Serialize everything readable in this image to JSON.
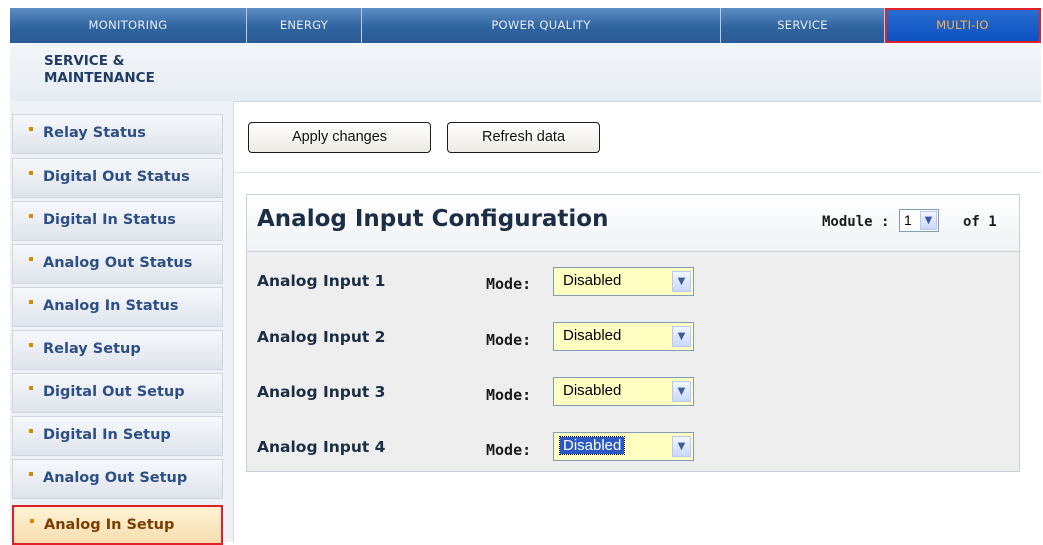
{
  "topnav": {
    "tabs": [
      {
        "label": "MONITORING"
      },
      {
        "label": "ENERGY"
      },
      {
        "label": "POWER QUALITY"
      },
      {
        "label": "SERVICE"
      },
      {
        "label": "MULTI-IO"
      }
    ],
    "active": "MULTI-IO"
  },
  "section": {
    "title": "SERVICE & MAINTENANCE"
  },
  "sidebar": {
    "items": [
      {
        "label": "Relay Status"
      },
      {
        "label": "Digital Out Status"
      },
      {
        "label": "Digital In Status"
      },
      {
        "label": "Analog Out Status"
      },
      {
        "label": "Analog In Status"
      },
      {
        "label": "Relay Setup"
      },
      {
        "label": "Digital Out Setup"
      },
      {
        "label": "Digital In Setup"
      },
      {
        "label": "Analog Out Setup"
      },
      {
        "label": "Analog In Setup"
      }
    ],
    "active": "Analog In Setup"
  },
  "toolbar": {
    "apply_label": "Apply changes",
    "refresh_label": "Refresh data"
  },
  "panel": {
    "title": "Analog Input Configuration",
    "module_label": "Module :",
    "module_value": "1",
    "of_label": "of 1",
    "rows": [
      {
        "label": "Analog Input 1",
        "mode_label": "Mode:",
        "mode_value": "Disabled"
      },
      {
        "label": "Analog Input 2",
        "mode_label": "Mode:",
        "mode_value": "Disabled"
      },
      {
        "label": "Analog Input 3",
        "mode_label": "Mode:",
        "mode_value": "Disabled"
      },
      {
        "label": "Analog Input 4",
        "mode_label": "Mode:",
        "mode_value": "Disabled"
      }
    ]
  },
  "colors": {
    "nav_bg": "#2f64a0",
    "nav_active_text": "#ffb347",
    "highlight_border": "#e0202a",
    "select_bg": "#ffffc2",
    "label_blue": "#2e4f86"
  },
  "icons": {
    "sidebar_bullet": "square-bullet-icon",
    "select_arrow": "chevron-down-icon"
  }
}
